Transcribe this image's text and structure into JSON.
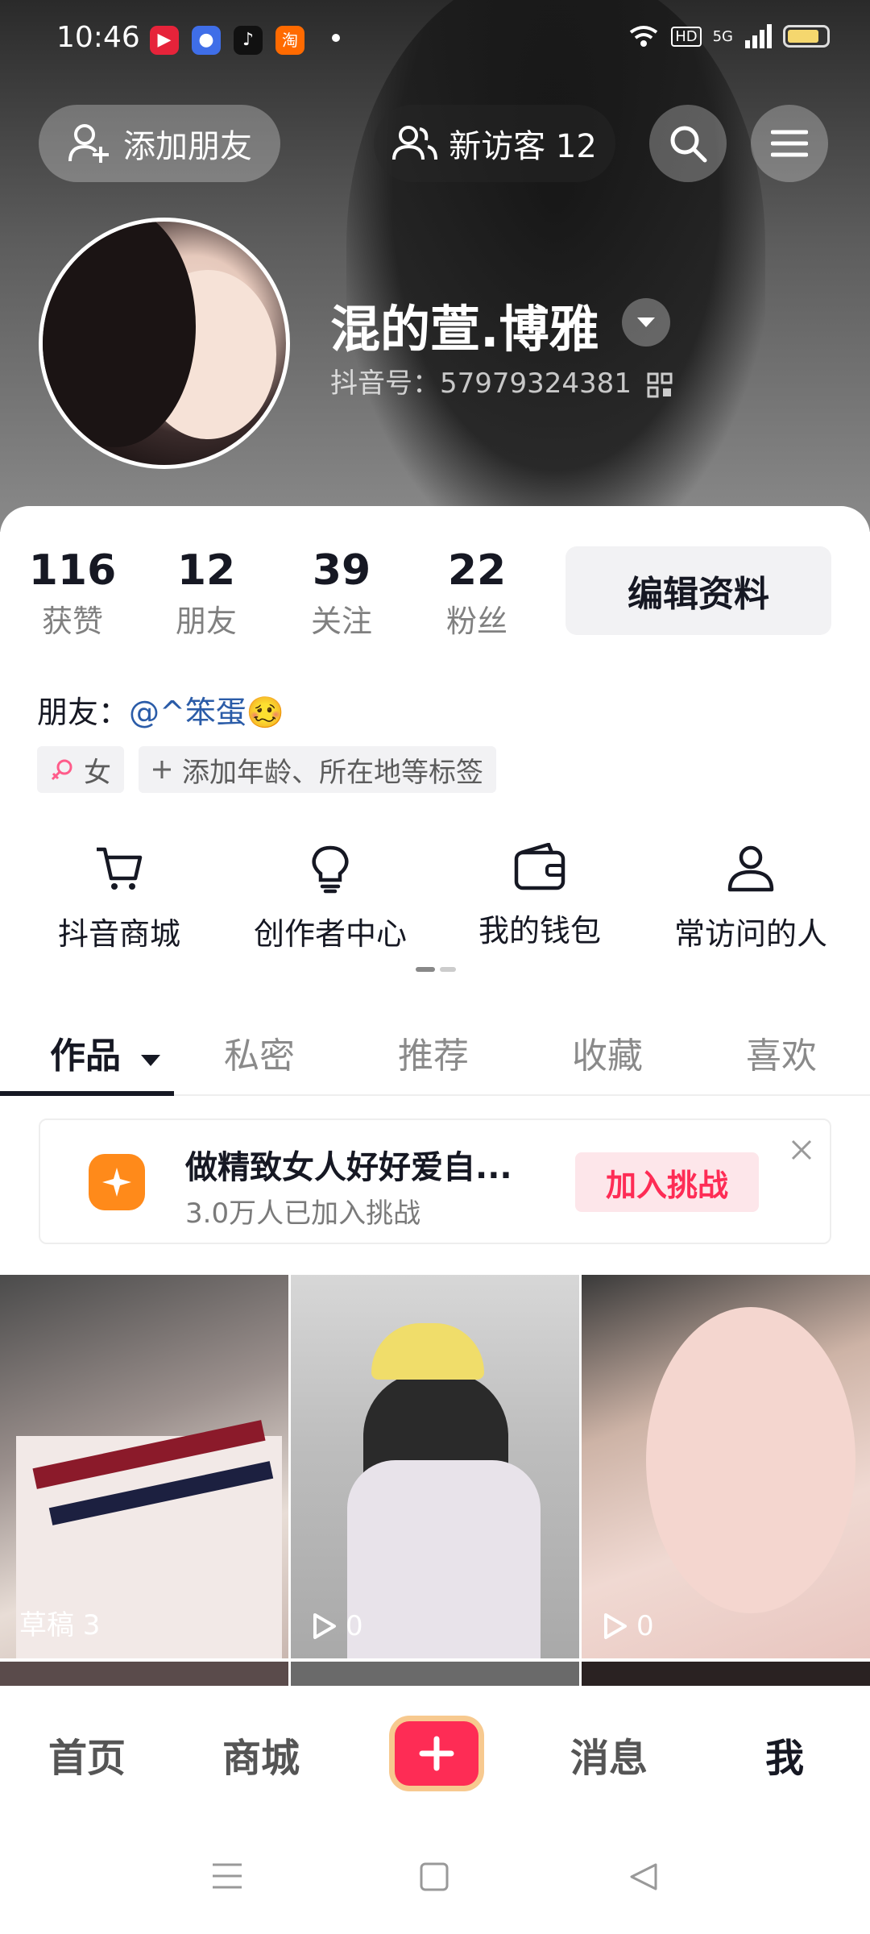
{
  "status_bar": {
    "time": "10:46",
    "apps": [
      {
        "name": "video-app-icon",
        "glyph": "▶",
        "color": "#e6233a"
      },
      {
        "name": "baidu-app-icon",
        "glyph": "🐾",
        "color": "#3f6ee8"
      },
      {
        "name": "tiktok-app-icon",
        "glyph": "♪",
        "color": "#111111"
      },
      {
        "name": "taobao-app-icon",
        "glyph": "淘",
        "color": "#ff6a00"
      }
    ],
    "hd": "HD",
    "network": "5G"
  },
  "header": {
    "add_friend_label": "添加朋友",
    "visitors_label": "新访客 12"
  },
  "profile": {
    "nickname": "混的萱.博雅",
    "douyin_id": "抖音号：57979324381"
  },
  "stats": [
    {
      "value": "116",
      "label": "获赞"
    },
    {
      "value": "12",
      "label": "朋友"
    },
    {
      "value": "39",
      "label": "关注"
    },
    {
      "value": "22",
      "label": "粉丝"
    }
  ],
  "edit_profile_label": "编辑资料",
  "friends": {
    "prefix": "朋友：",
    "mention": "@^笨蛋🥴"
  },
  "tags": {
    "gender": "女",
    "add_tags": "添加年龄、所在地等标签"
  },
  "shortcuts": [
    {
      "label": "抖音商城",
      "icon": "cart-icon"
    },
    {
      "label": "创作者中心",
      "icon": "bulb-icon"
    },
    {
      "label": "我的钱包",
      "icon": "wallet-icon"
    },
    {
      "label": "常访问的人",
      "icon": "person-icon"
    }
  ],
  "tabs": [
    "作品",
    "私密",
    "推荐",
    "收藏",
    "喜欢"
  ],
  "challenge_banner": {
    "title": "做精致女人好好爱自...",
    "subtitle": "3.0万人已加入挑战",
    "button": "加入挑战"
  },
  "videos": [
    {
      "label": "草稿 3"
    },
    {
      "label": "0"
    },
    {
      "label": "0"
    }
  ],
  "bottom_nav": [
    "首页",
    "商城",
    "消息",
    "我"
  ],
  "colors": {
    "accent": "#fe2c55",
    "mention": "#2b5ca8",
    "challenge": "#ff8a1a"
  }
}
